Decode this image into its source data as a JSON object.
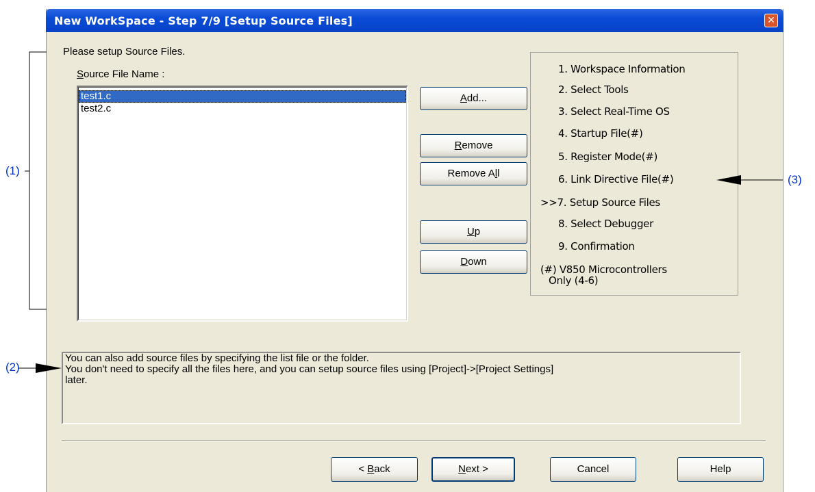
{
  "window": {
    "title": "New WorkSpace - Step 7/9 [Setup Source Files]"
  },
  "page": {
    "instruction": "Please setup Source Files.",
    "source_label_pre": "",
    "source_label_key": "S",
    "source_label_rest": "ource File Name :"
  },
  "files": [
    "test1.c",
    "test2.c"
  ],
  "buttons": {
    "add": {
      "key": "A",
      "rest": "dd..."
    },
    "remove": {
      "key": "R",
      "rest": "emove"
    },
    "remove_all": {
      "pre": "Remove A",
      "key": "l",
      "rest": "l"
    },
    "up": {
      "key": "U",
      "rest": "p"
    },
    "down": {
      "key": "D",
      "rest": "own"
    }
  },
  "steps": [
    "1. Workspace Information",
    "2. Select Tools",
    "3. Select Real-Time OS",
    "4. Startup File(#)",
    "5. Register Mode(#)",
    "6. Link Directive File(#)",
    ">>7. Setup Source Files",
    "8. Select Debugger",
    "9. Confirmation"
  ],
  "steps_note": [
    "(#) V850 Microcontrollers",
    "Only (4-6)"
  ],
  "hint_lines": [
    "You can also add source files by specifying the list file or the folder.",
    "You don't need to specify all the files here, and you can setup source files using [Project]->[Project Settings]",
    "later."
  ],
  "footer": {
    "back": {
      "pre": "< ",
      "key": "B",
      "rest": "ack"
    },
    "next": {
      "pre": "",
      "key": "N",
      "rest": "ext >"
    },
    "cancel": "Cancel",
    "help": "Help"
  },
  "annotations": {
    "a1": "(1)",
    "a2": "(2)",
    "a3": "(3)"
  },
  "colors": {
    "annotation": "#0033cc",
    "selection": "#316ac5",
    "titlebar": "#0a4bd6"
  }
}
